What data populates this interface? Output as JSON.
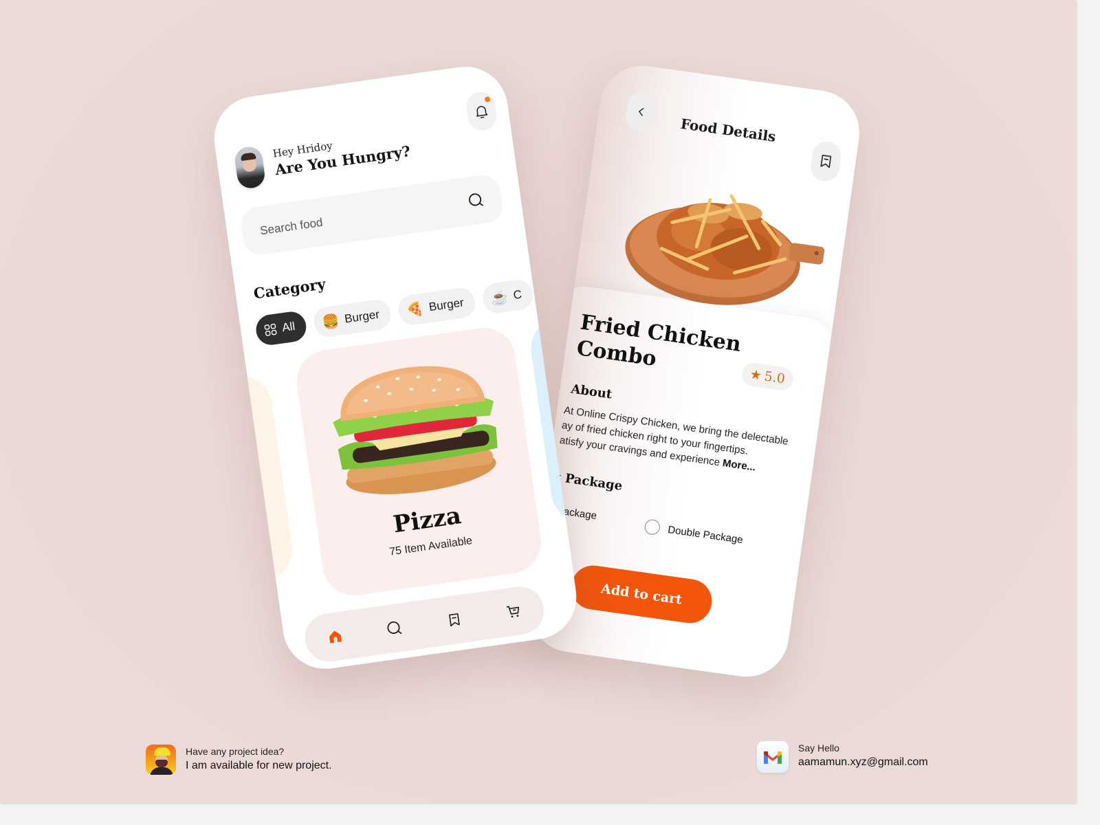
{
  "home": {
    "greeting_small": "Hey Hridoy",
    "greeting_big": "Are You Hungry?",
    "notification_dot_color": "#f47b20",
    "search": {
      "placeholder": "Search food"
    },
    "category_title": "Category",
    "categories": [
      {
        "label": "All",
        "icon": "grid-icon",
        "active": true
      },
      {
        "label": "Burger",
        "icon": "🍔",
        "active": false
      },
      {
        "label": "Burger",
        "icon": "🍕",
        "active": false
      },
      {
        "label": "C",
        "icon": "☕",
        "active": false
      }
    ],
    "featured": {
      "name": "Pizza",
      "count_text": "75 Item Available"
    },
    "bottom_nav": [
      {
        "name": "home",
        "icon": "home-icon",
        "active": true
      },
      {
        "name": "search",
        "icon": "search-icon",
        "active": false
      },
      {
        "name": "saved",
        "icon": "bookmark-icon",
        "active": false
      },
      {
        "name": "cart",
        "icon": "cart-icon",
        "active": false
      }
    ],
    "accent_color": "#f1560c"
  },
  "details": {
    "title": "Food Details",
    "dish_name": "Fried Chicken Combo",
    "rating": "5.0",
    "rating_color": "#d96a0b",
    "about_title": "About",
    "about_lines": [
      "At Online Crispy Chicken, we bring the delectable",
      "ay of fried chicken right to your fingertips.",
      "atisfy your cravings and experience"
    ],
    "more_label": "More...",
    "package_title": "ct Package",
    "packages": [
      {
        "label": "gle Package",
        "selected": true
      },
      {
        "label": "Double Package",
        "selected": false
      }
    ],
    "cta_label": "Add to cart"
  },
  "footer": {
    "left": {
      "line1": "Have any project idea?",
      "line2": "I am available for new project."
    },
    "right": {
      "line1": "Say Hello",
      "line2": "aamamun.xyz@gmail.com"
    }
  }
}
